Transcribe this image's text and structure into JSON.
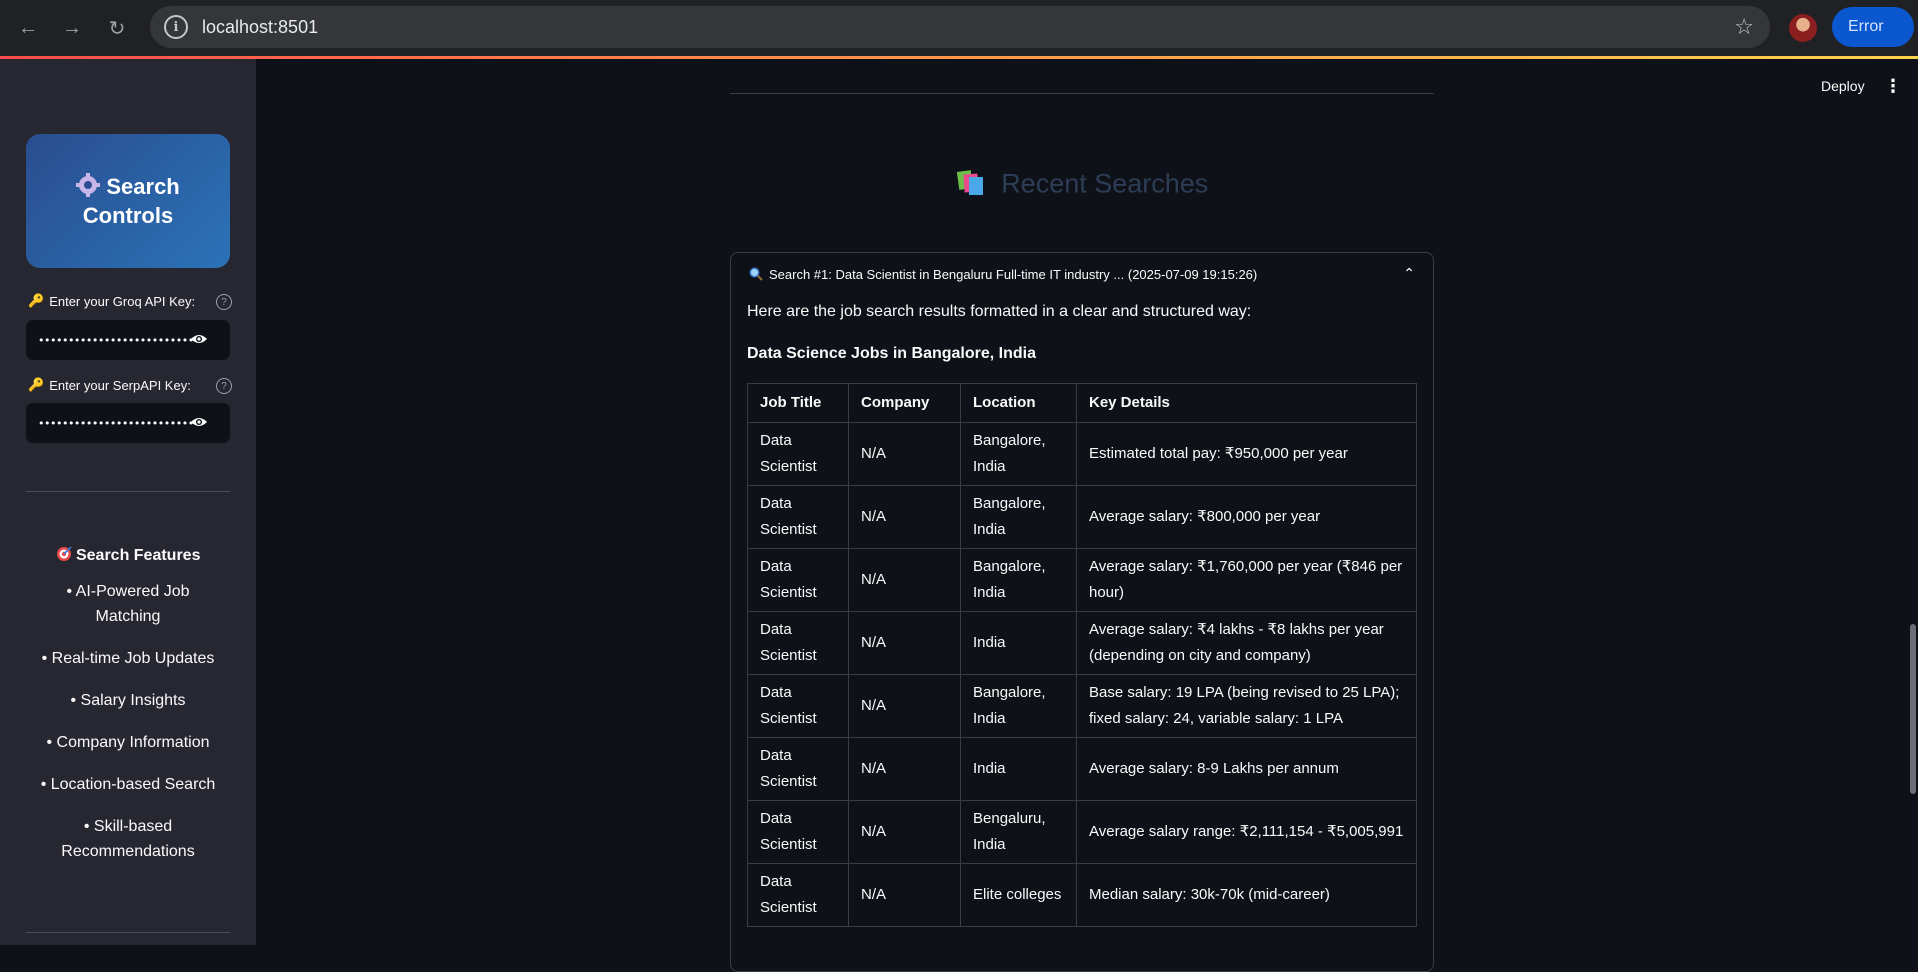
{
  "browser": {
    "url": "localhost:8501",
    "error_label": "Error"
  },
  "sidebar": {
    "card_title_line1": "Search",
    "card_title_line2": "Controls",
    "groq_label": "Enter your Groq API Key:",
    "groq_value": "••••••••••••••••••••••••••••",
    "serp_label": "Enter your SerpAPI Key:",
    "serp_value": "••••••••••••••••••••••••••••",
    "features_title": "Search Features",
    "features": [
      "• AI-Powered Job Matching",
      "• Real-time Job Updates",
      "• Salary Insights",
      "• Company Information",
      "• Location-based Search",
      "• Skill-based Recommendations"
    ]
  },
  "header": {
    "deploy_label": "Deploy",
    "kebab": "⋮"
  },
  "main": {
    "recent_title": "Recent Searches",
    "expander_title": "Search #1: Data Scientist in Bengaluru Full-time IT industry ... (2025-07-09 19:15:26)",
    "intro": "Here are the job search results formatted in a clear and structured way:",
    "subheading": "Data Science Jobs in Bangalore, India",
    "columns": [
      "Job Title",
      "Company",
      "Location",
      "Key Details"
    ],
    "rows": [
      [
        "Data Scientist",
        "N/A",
        "Bangalore, India",
        "Estimated total pay: ₹950,000 per year"
      ],
      [
        "Data Scientist",
        "N/A",
        "Bangalore, India",
        "Average salary: ₹800,000 per year"
      ],
      [
        "Data Scientist",
        "N/A",
        "Bangalore, India",
        "Average salary: ₹1,760,000 per year (₹846 per hour)"
      ],
      [
        "Data Scientist",
        "N/A",
        "India",
        "Average salary: ₹4 lakhs - ₹8 lakhs per year (depending on city and company)"
      ],
      [
        "Data Scientist",
        "N/A",
        "Bangalore, India",
        "Base salary: 19 LPA (being revised to 25 LPA); fixed salary: 24, variable salary: 1 LPA"
      ],
      [
        "Data Scientist",
        "N/A",
        "India",
        "Average salary: 8-9 Lakhs per annum"
      ],
      [
        "Data Scientist",
        "N/A",
        "Bengaluru, India",
        "Average salary range: ₹2,111,154 - ₹5,005,991"
      ],
      [
        "Data Scientist",
        "N/A",
        "Elite colleges",
        "Median salary: 30k-70k (mid-career)"
      ]
    ]
  }
}
